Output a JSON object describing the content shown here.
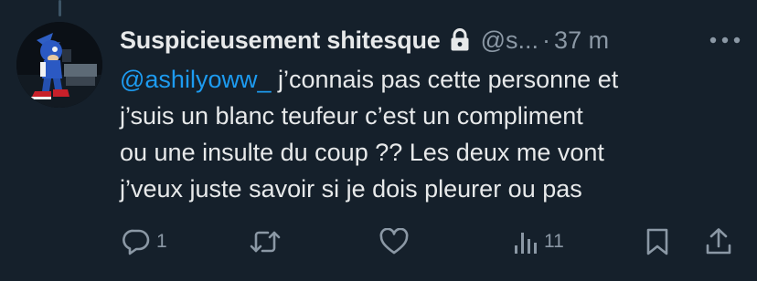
{
  "tweet": {
    "display_name": "Suspicieusement shitesque",
    "handle": "@s...",
    "separator": "·",
    "time": "37 m",
    "protected_icon": "lock-icon",
    "more_icon": "ellipsis-icon",
    "mention": "@ashilyoww_",
    "line1_rest": " j’connais pas cette personne et",
    "line2": "j’suis un blanc teufeur c’est un compliment",
    "line3": "ou une insulte du coup ?? Les deux me vont",
    "line4": "j’veux juste savoir si je dois pleurer ou pas"
  },
  "actions": {
    "reply_count": "1",
    "retweet_count": "",
    "like_count": "",
    "views_count": "11",
    "icons": [
      "reply-icon",
      "retweet-icon",
      "like-icon",
      "views-icon",
      "bookmark-icon",
      "share-icon"
    ]
  },
  "colors": {
    "background": "#15202b",
    "text": "#e7e9ea",
    "secondary": "#8b98a5",
    "accent": "#1d9bf0"
  }
}
